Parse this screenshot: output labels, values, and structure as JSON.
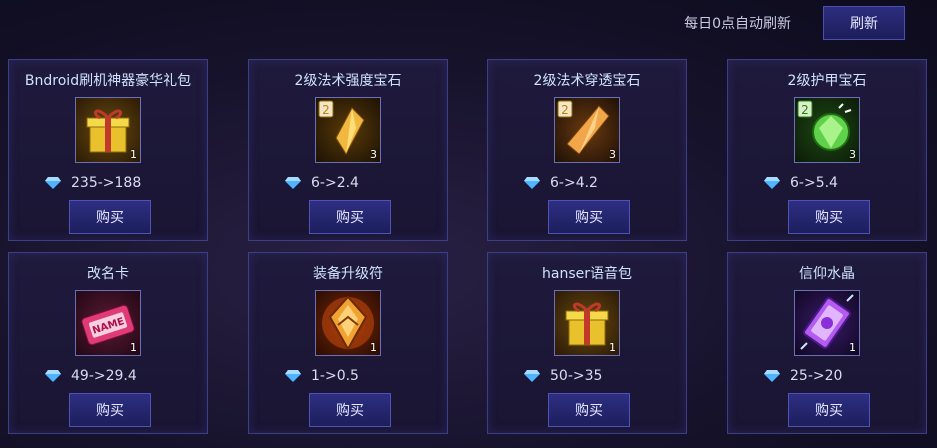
{
  "header": {
    "refresh_note": "每日0点自动刷新",
    "refresh_label": "刷新"
  },
  "shop": {
    "items": [
      {
        "name": "Bndroid刷机神器豪华礼包",
        "icon": "gift-box-icon",
        "count": "1",
        "price": "235->188",
        "buy_label": "购买"
      },
      {
        "name": "2级法术强度宝石",
        "icon": "spell-power-gem-icon",
        "count": "3",
        "price": "6->2.4",
        "buy_label": "购买"
      },
      {
        "name": "2级法术穿透宝石",
        "icon": "spell-penetration-gem-icon",
        "count": "3",
        "price": "6->4.2",
        "buy_label": "购买"
      },
      {
        "name": "2级护甲宝石",
        "icon": "armor-gem-icon",
        "count": "3",
        "price": "6->5.4",
        "buy_label": "购买"
      },
      {
        "name": "改名卡",
        "icon": "rename-card-icon",
        "count": "1",
        "price": "49->29.4",
        "buy_label": "购买"
      },
      {
        "name": "装备升级符",
        "icon": "upgrade-rune-icon",
        "count": "1",
        "price": "1->0.5",
        "buy_label": "购买"
      },
      {
        "name": "hanser语音包",
        "icon": "gift-box-icon",
        "count": "1",
        "price": "50->35",
        "buy_label": "购买"
      },
      {
        "name": "信仰水晶",
        "icon": "faith-crystal-icon",
        "count": "1",
        "price": "25->20",
        "buy_label": "购买"
      }
    ],
    "gem_level_badge": "2",
    "rename_card_text": "NAME"
  },
  "colors": {
    "accent": "#2e2f82",
    "border": "#3d3f86",
    "diamond": "#4fb4ff"
  }
}
